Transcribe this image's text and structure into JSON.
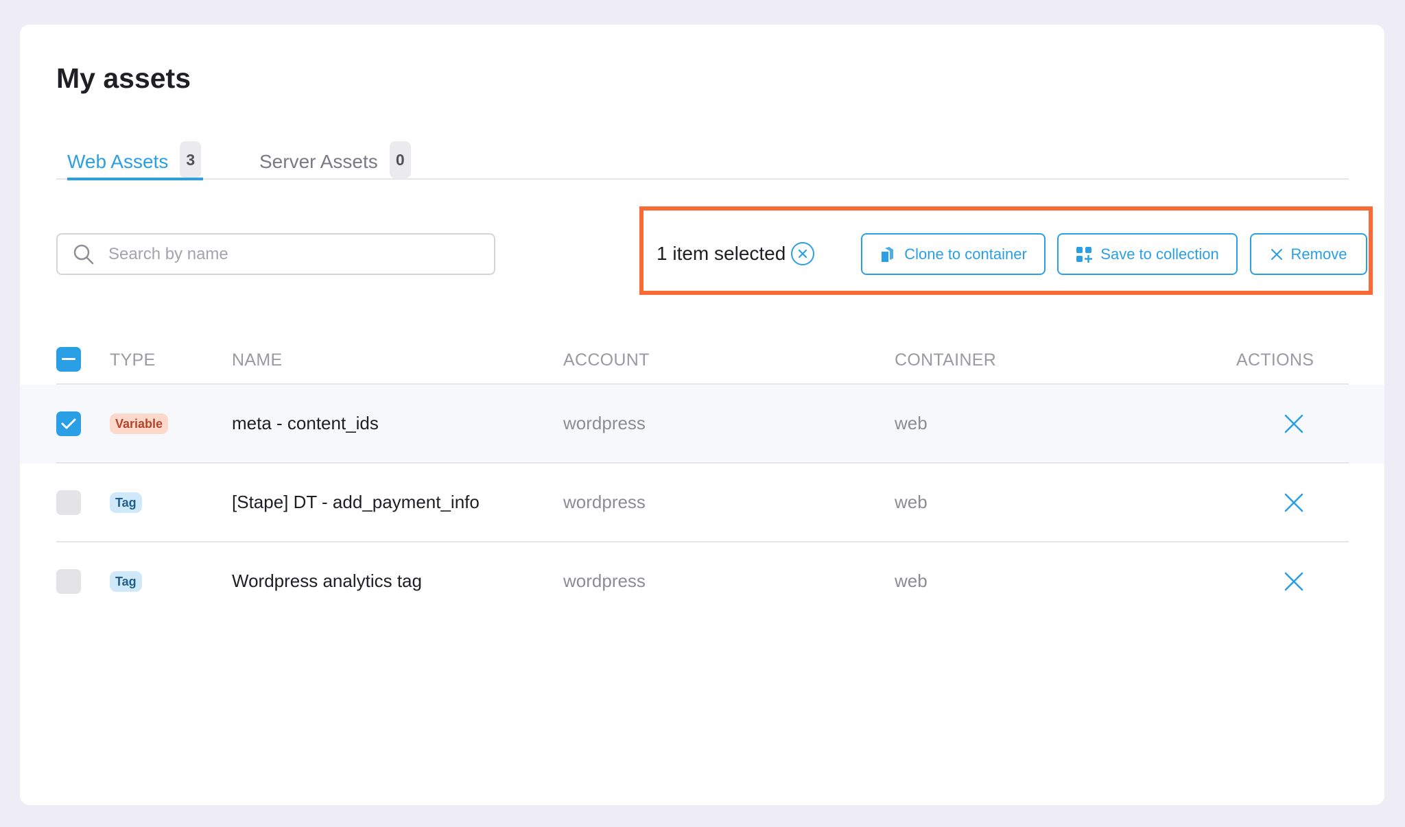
{
  "page": {
    "title": "My assets"
  },
  "tabs": [
    {
      "label": "Web Assets",
      "count": "3",
      "active": true
    },
    {
      "label": "Server Assets",
      "count": "0",
      "active": false
    }
  ],
  "search": {
    "placeholder": "Search by name",
    "value": ""
  },
  "selection": {
    "count_text": "1 item selected",
    "actions": {
      "clone": "Clone to container",
      "save": "Save to collection",
      "remove": "Remove"
    }
  },
  "table": {
    "headers": {
      "type": "TYPE",
      "name": "NAME",
      "account": "ACCOUNT",
      "container": "CONTAINER",
      "actions": "ACTIONS"
    },
    "rows": [
      {
        "type": "Variable",
        "name": "meta - content_ids",
        "account": "wordpress",
        "container": "web",
        "checked": true
      },
      {
        "type": "Tag",
        "name": "[Stape] DT - add_payment_info",
        "account": "wordpress",
        "container": "web",
        "checked": false
      },
      {
        "type": "Tag",
        "name": "Wordpress analytics tag",
        "account": "wordpress",
        "container": "web",
        "checked": false
      }
    ]
  },
  "colors": {
    "accent": "#2b9fe5",
    "highlight": "#fb6a35",
    "background": "#eeedf6",
    "variable_badge": "#fdd9cc",
    "tag_badge": "#cfe9fb"
  },
  "icons": {
    "search": "search-icon",
    "clear": "close-circle-icon",
    "clone": "clone-icon",
    "save": "collection-icon",
    "remove": "close-icon",
    "header_checkbox": "minus-icon",
    "row_checkbox": "check-icon",
    "row_action": "close-icon"
  }
}
